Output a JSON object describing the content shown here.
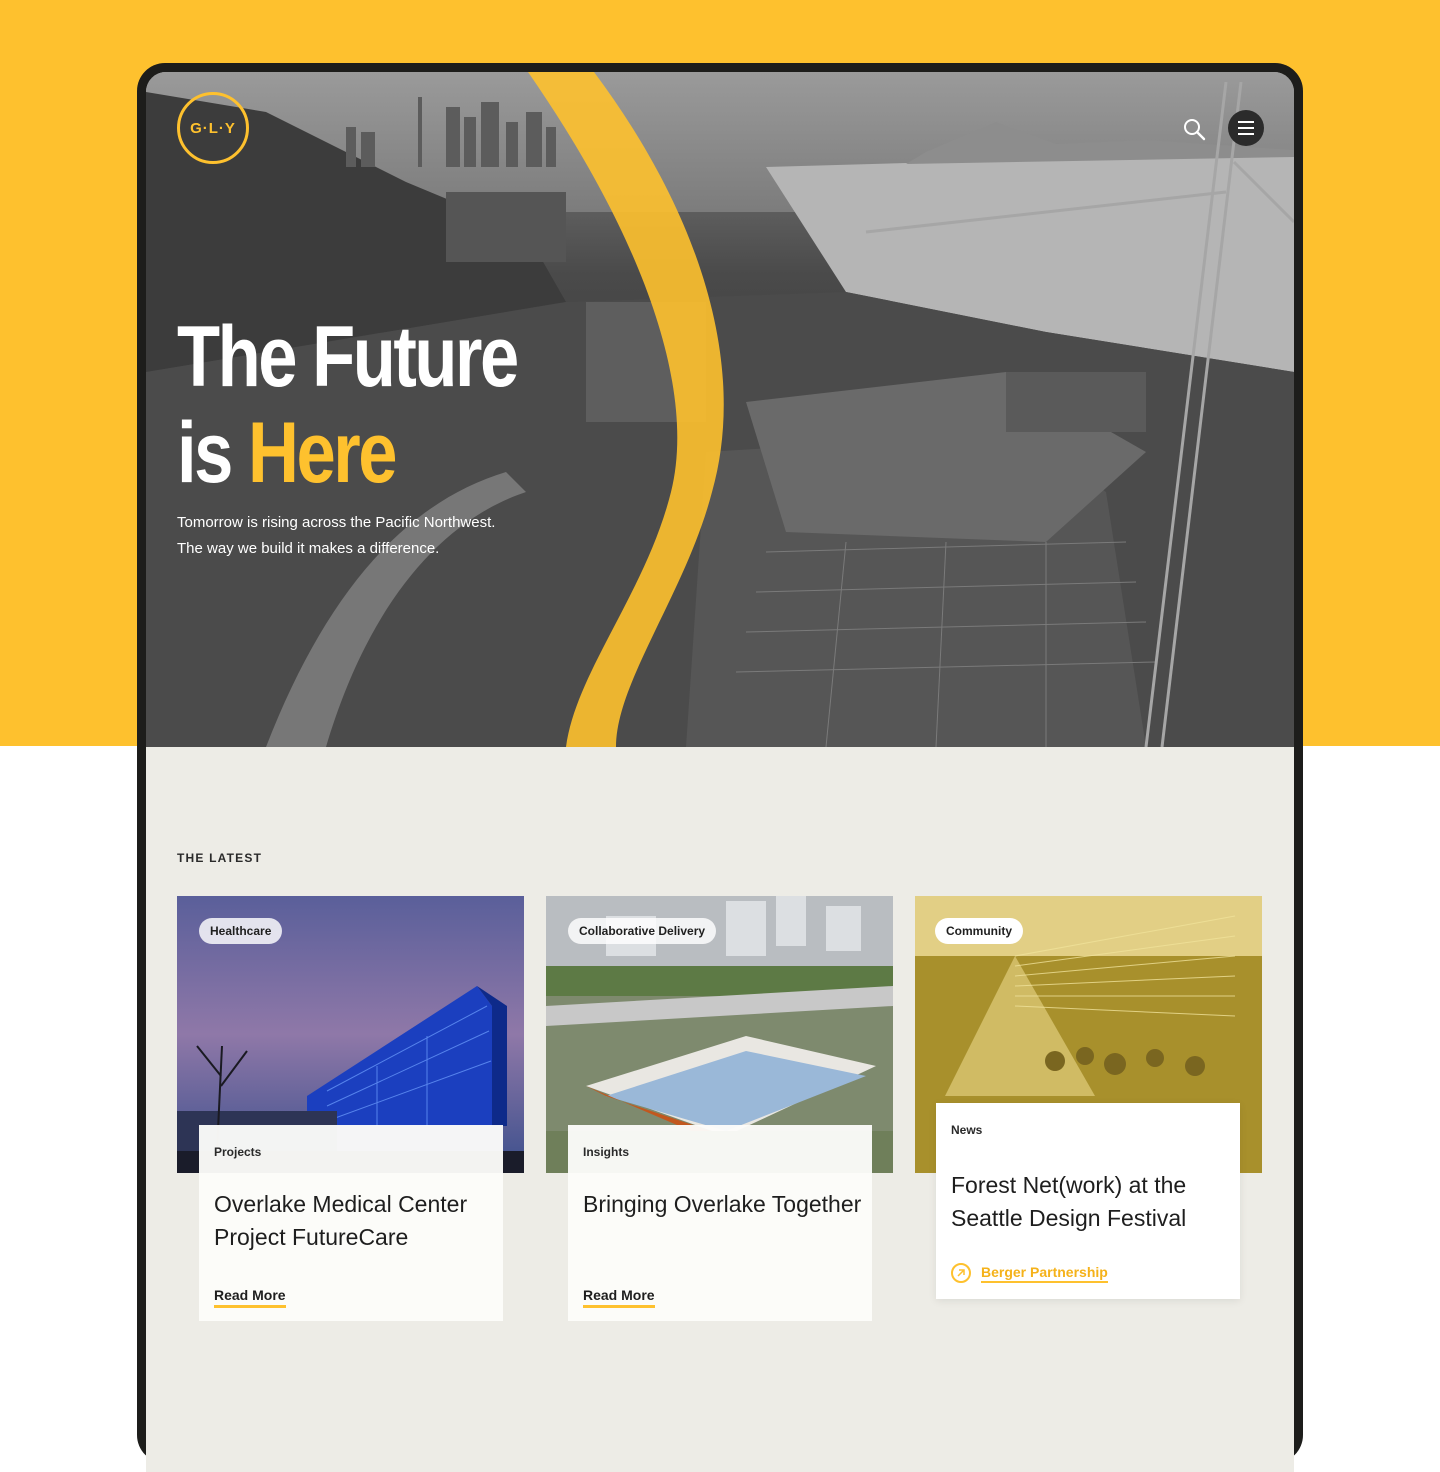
{
  "brand": {
    "logo_text": "G·L·Y",
    "accent": "#FEC12E"
  },
  "header": {
    "search_icon": "search-icon",
    "menu_icon": "hamburger-menu-icon"
  },
  "hero": {
    "title_line1": "The Future",
    "title_line2_prefix": "is ",
    "title_line2_highlight": "Here",
    "subtitle_line1": "Tomorrow is rising across the Pacific Northwest.",
    "subtitle_line2": "The way we build it makes a difference."
  },
  "latest": {
    "heading": "THE LATEST",
    "cards": [
      {
        "tag": "Healthcare",
        "category": "Projects",
        "title": "Overlake Medical Center Project FutureCare",
        "cta": "Read More"
      },
      {
        "tag": "Collaborative Delivery",
        "category": "Insights",
        "title": "Bringing Overlake Together",
        "cta": "Read More"
      },
      {
        "tag": "Community",
        "category": "News",
        "title": "Forest Net(work) at the Seattle Design Festival",
        "link": "Berger Partnership",
        "link_icon": "external-arrow-icon"
      }
    ]
  }
}
